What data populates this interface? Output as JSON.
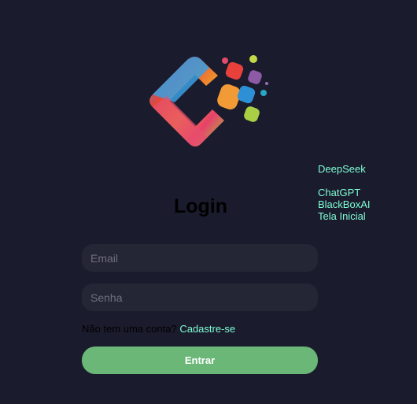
{
  "header": {
    "logo_name": "colorful-c-logo"
  },
  "nav": {
    "links": [
      "DeepSeek",
      "ChatGPT",
      "BlackBoxAI",
      "Tela Inicial"
    ]
  },
  "login": {
    "title": "Login",
    "email_placeholder": "Email",
    "password_placeholder": "Senha",
    "no_account_text": "Não tem uma conta?",
    "signup_link": "Cadastre-se",
    "submit_label": "Entrar"
  },
  "colors": {
    "background": "#1b1b2e",
    "input_background": "#252635",
    "accent_link": "#7fffd4",
    "button": "#6ab777"
  }
}
